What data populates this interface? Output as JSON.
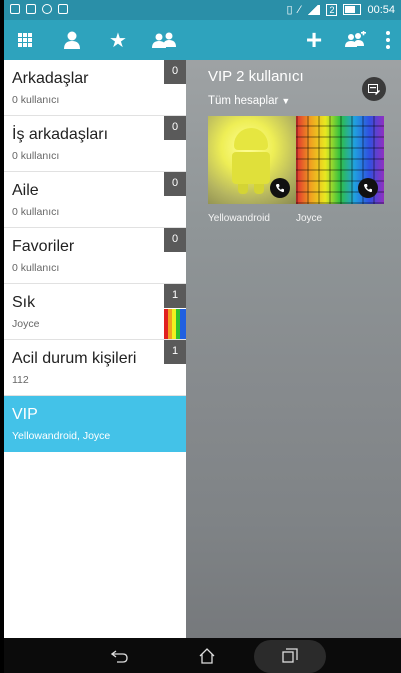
{
  "status_bar": {
    "time": "00:54",
    "sim_badge": "2",
    "icons": [
      "calendar-icon",
      "mail-icon",
      "chat-icon",
      "image-icon",
      "vibrate-icon",
      "mute-icon",
      "signal-icon",
      "battery-icon"
    ]
  },
  "toolbar": {
    "icons": [
      "apps-grid-icon",
      "person-icon",
      "star-icon",
      "groups-icon",
      "add-icon",
      "add-group-icon",
      "more-icon"
    ]
  },
  "groups": [
    {
      "name": "Arkadaşlar",
      "sub": "0 kullanıcı",
      "count": "0"
    },
    {
      "name": "İş arkadaşları",
      "sub": "0 kullanıcı",
      "count": "0"
    },
    {
      "name": "Aile",
      "sub": "0 kullanıcı",
      "count": "0"
    },
    {
      "name": "Favoriler",
      "sub": "0 kullanıcı",
      "count": "0"
    },
    {
      "name": "Sık",
      "sub": "Joyce",
      "count": "1"
    },
    {
      "name": "Acil durum kişileri",
      "sub": "112",
      "count": "1"
    },
    {
      "name": "VIP",
      "sub": "Yellowandroid, Joyce",
      "count": ""
    }
  ],
  "detail": {
    "title": "VIP 2 kullanıcı",
    "account_filter": "Tüm hesaplar",
    "contacts": [
      {
        "name": "Yellowandroid"
      },
      {
        "name": "Joyce"
      }
    ]
  },
  "colors": {
    "status_bar": "#2a8fa8",
    "toolbar": "#2ea3bd",
    "selected_group": "#43c2e8",
    "count_badge": "#5a5a5a"
  }
}
